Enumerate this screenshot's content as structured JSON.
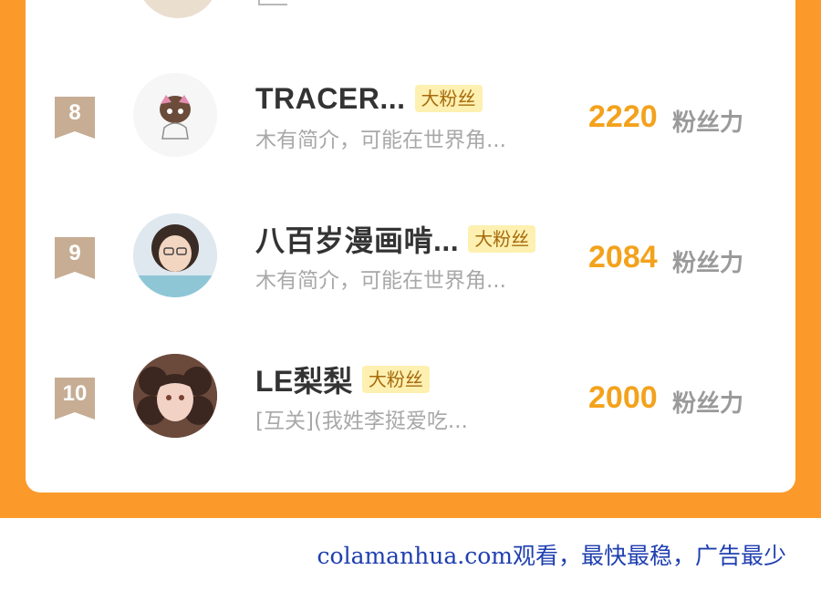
{
  "ranking": {
    "rows": [
      {
        "rank": "8",
        "name": "TRACER...",
        "tag": "大粉丝",
        "bio": "木有简介，可能在世界角...",
        "score": "2220",
        "score_unit": "粉丝力"
      },
      {
        "rank": "9",
        "name": "八百岁漫画啃...",
        "tag": "大粉丝",
        "bio": "木有简介，可能在世界角...",
        "score": "2084",
        "score_unit": "粉丝力"
      },
      {
        "rank": "10",
        "name": "LE梨梨",
        "tag": "大粉丝",
        "bio": "[互关](我姓李挺爱吃...",
        "score": "2000",
        "score_unit": "粉丝力"
      }
    ]
  },
  "footer": {
    "text": "colamanhua.com观看，最快最稳，广告最少"
  },
  "colors": {
    "panel": "#fb9a2b",
    "score": "#f3a21c",
    "tag_bg": "#fdf0b0",
    "footer_text": "#1f3fb0"
  }
}
